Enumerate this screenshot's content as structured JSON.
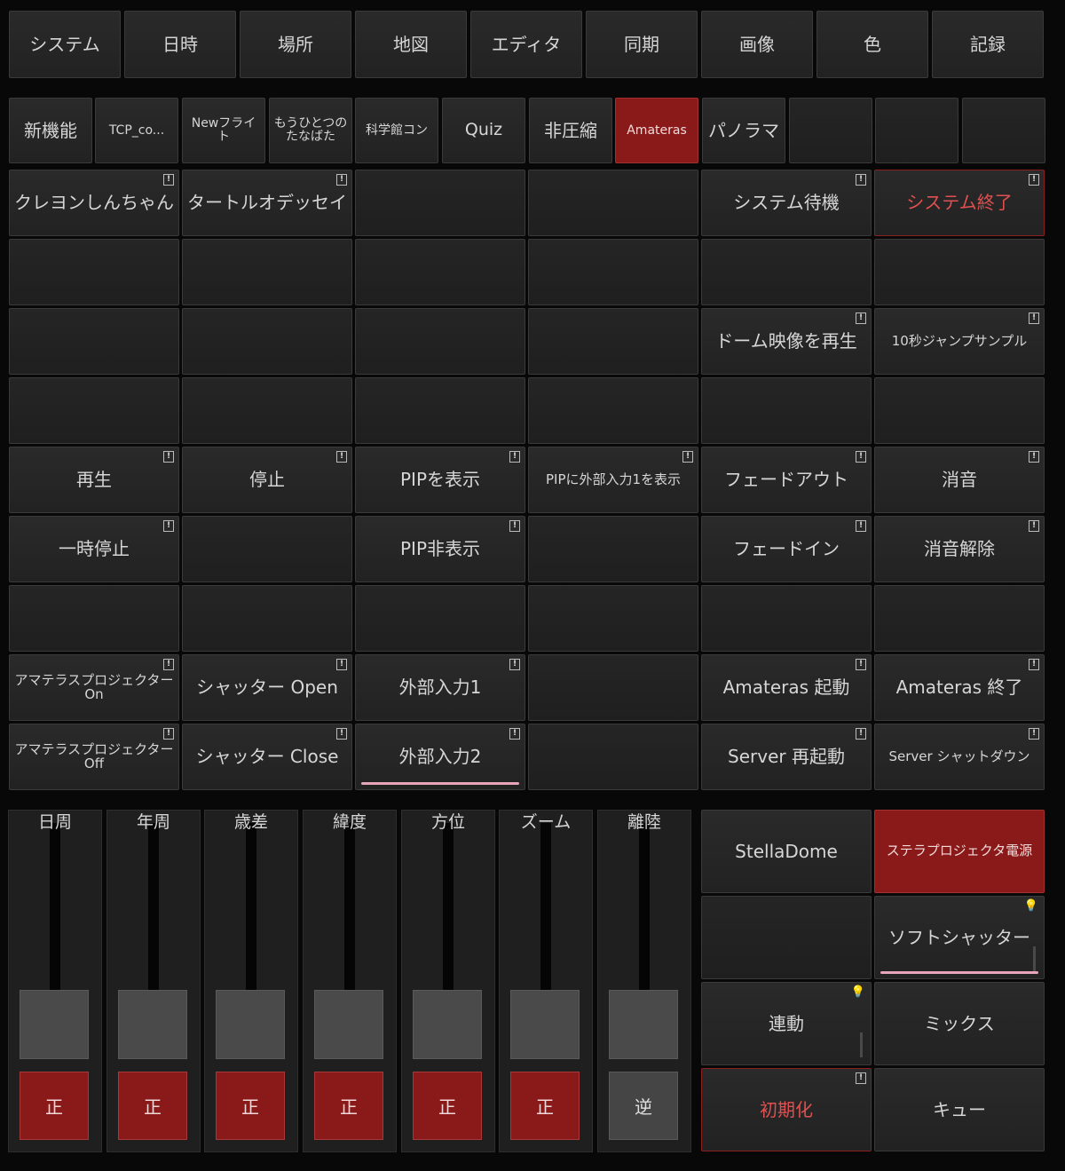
{
  "top_tabs": [
    "システム",
    "日時",
    "場所",
    "地図",
    "エディタ",
    "同期",
    "画像",
    "色",
    "記録"
  ],
  "sub_tabs": [
    "新機能",
    "TCP_co...",
    "Newフライト",
    "もうひとつのたなばた",
    "科学館コン",
    "Quiz",
    "非圧縮",
    "Amateras",
    "パノラマ",
    "",
    "",
    ""
  ],
  "selected_sub_tab": "Amateras",
  "grid": [
    [
      "クレヨンしんちゃん",
      "タートルオデッセイ",
      "",
      "",
      "システム待機",
      "システム終了"
    ],
    [
      "",
      "",
      "",
      "",
      "",
      ""
    ],
    [
      "",
      "",
      "",
      "",
      "ドーム映像を再生",
      "10秒ジャンプサンプル"
    ],
    [
      "",
      "",
      "",
      "",
      "",
      ""
    ],
    [
      "再生",
      "停止",
      "PIPを表示",
      "PIPに外部入力1を表示",
      "フェードアウト",
      "消音"
    ],
    [
      "一時停止",
      "",
      "PIP非表示",
      "",
      "フェードイン",
      "消音解除"
    ],
    [
      "",
      "",
      "",
      "",
      "",
      ""
    ],
    [
      "アマテラスプロジェクター On",
      "シャッター Open",
      "外部入力1",
      "",
      "Amateras 起動",
      "Amateras 終了"
    ],
    [
      "アマテラスプロジェクター Off",
      "シャッター Close",
      "外部入力2",
      "",
      "Server 再起動",
      "Server シャットダウン"
    ]
  ],
  "sliders": [
    {
      "label": "日周",
      "direction": "正"
    },
    {
      "label": "年周",
      "direction": "正"
    },
    {
      "label": "歳差",
      "direction": "正"
    },
    {
      "label": "緯度",
      "direction": "正"
    },
    {
      "label": "方位",
      "direction": "正"
    },
    {
      "label": "ズーム",
      "direction": "正"
    },
    {
      "label": "離陸",
      "direction": "逆"
    }
  ],
  "right_panel": [
    "StellaDome",
    "ステラプロジェクタ電源",
    "",
    "ソフトシャッター",
    "連動",
    "ミックス",
    "初期化",
    "キュー"
  ],
  "colors": {
    "active": "#8a1a1a",
    "alert_text": "#e05050",
    "underline": "#e8a4b8"
  }
}
